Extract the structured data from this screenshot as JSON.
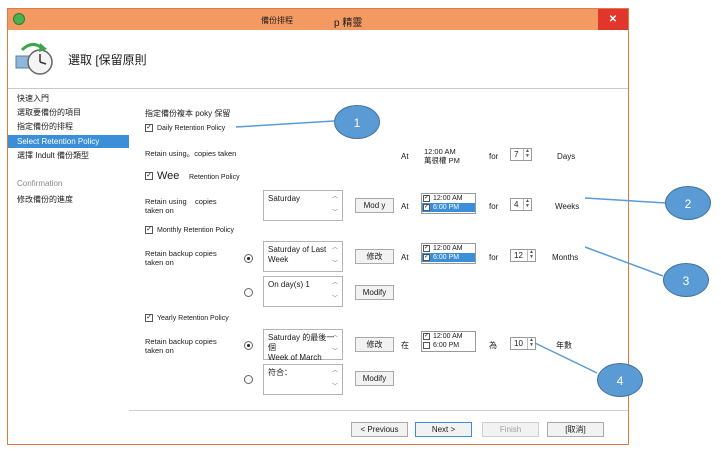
{
  "window": {
    "title": "備份排程",
    "app_title": "p 精靈"
  },
  "header": {
    "heading": "選取 [保留原則"
  },
  "sidebar": {
    "items": [
      {
        "label": "快速入門",
        "state": "normal"
      },
      {
        "label": "選取要備份的項目",
        "state": "normal"
      },
      {
        "label": "指定備份的排程",
        "state": "normal"
      },
      {
        "label": "Select Retention Policy",
        "state": "active"
      },
      {
        "label": "選擇 Indult 備份類型",
        "state": "normal"
      },
      {
        "label": "Confirmation",
        "state": "dim"
      },
      {
        "label": "修改備份的進度",
        "state": "normal"
      }
    ]
  },
  "content": {
    "intro": "指定備份複本 poky 保留",
    "daily": {
      "checkbox_label": "Daily Retention Policy",
      "checked": true,
      "retain_text": "Retain using。copies taken",
      "at_label": "At",
      "time_line1": "12:00 AM",
      "time_line2": "萬很權 PM",
      "for_label": "for",
      "count": "7",
      "unit": "Days"
    },
    "weekly": {
      "checkbox_label_prefix": "Wee",
      "checkbox_label_suffix": "Retention Policy",
      "checked": true,
      "retain_line1": "Retain using",
      "retain_line2": "copies",
      "retain_line3": "taken on",
      "days_value": "Saturday",
      "modify_label": "Mod y",
      "at_label": "At",
      "times": [
        {
          "label": "12:00 AM",
          "checked": true,
          "selected": false
        },
        {
          "label": "6:00 PM",
          "checked": true,
          "selected": true
        }
      ],
      "for_label": "for",
      "count": "4",
      "unit": "Weeks"
    },
    "monthly": {
      "checkbox_label": "Monthly Retention Policy",
      "checked": true,
      "retain_line1": "Retain backup copies",
      "retain_line2": "taken on",
      "option1_line1": "Saturday of Last",
      "option1_line2": "Week",
      "option1_modify": "修改",
      "option2_value": "On day(s) 1",
      "option2_modify": "Modify",
      "at_label": "At",
      "times": [
        {
          "label": "12:00 AM",
          "checked": true,
          "selected": false
        },
        {
          "label": "6:00 PM",
          "checked": true,
          "selected": true
        }
      ],
      "for_label": "for",
      "count": "12",
      "unit": "Months"
    },
    "yearly": {
      "checkbox_label": "Yearly Retention Policy",
      "checked": true,
      "retain_line1": "Retain backup copies",
      "retain_line2": "taken on",
      "option1_line1": "Saturday 的最後一個",
      "option1_line2": "Week of March",
      "option1_modify": "修改",
      "option2_value": "符合：",
      "option2_modify": "Modify",
      "at_label": "在",
      "times": [
        {
          "label": "12:00 AM",
          "checked": true,
          "selected": false
        },
        {
          "label": "6:00 PM",
          "checked": false,
          "selected": false
        }
      ],
      "for_label": "為",
      "count": "10",
      "unit": "年數"
    }
  },
  "footer": {
    "previous": "< Previous",
    "next": "Next >",
    "finish": "Finish",
    "cancel": "[取消]"
  },
  "callouts": [
    "1",
    "2",
    "3",
    "4"
  ],
  "colors": {
    "titlebar": "#f39a63",
    "close": "#e0362c",
    "accent": "#3a8fd8",
    "callout": "#5b9bd5"
  }
}
